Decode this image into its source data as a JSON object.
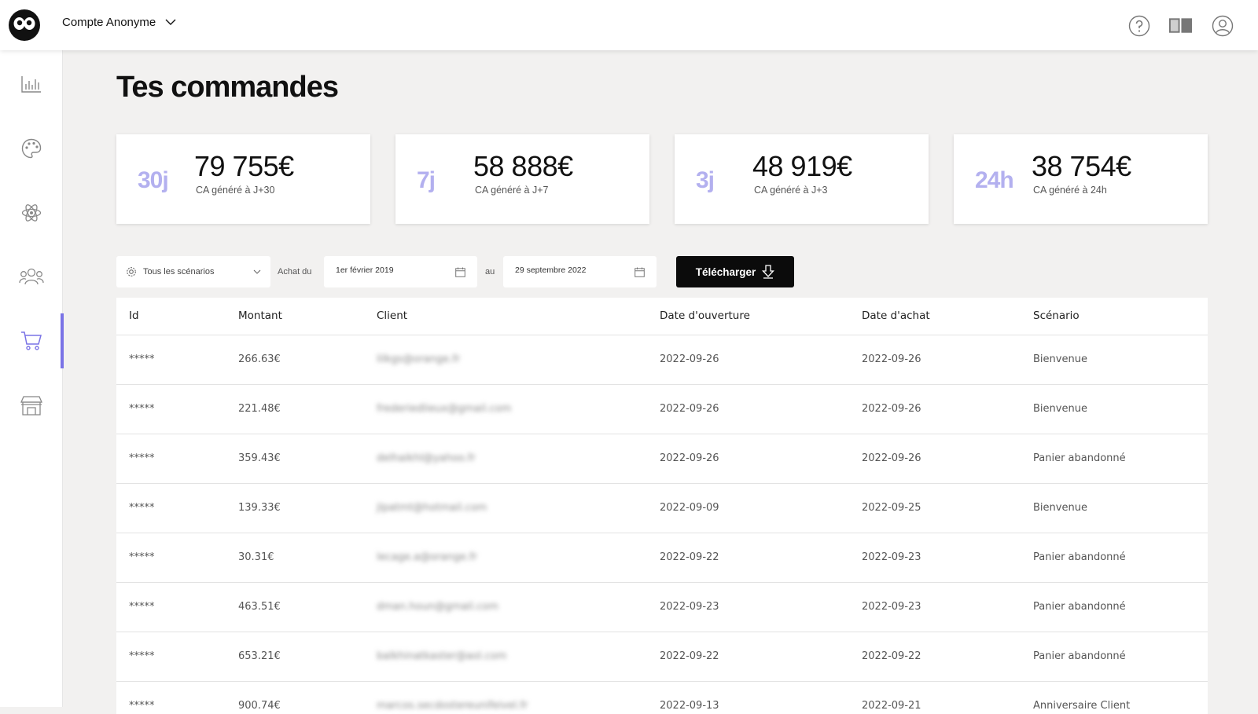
{
  "header": {
    "account_name": "Compte Anonyme",
    "icons": [
      "help-icon",
      "book-icon",
      "user-icon"
    ]
  },
  "sidebar": {
    "items": [
      {
        "name": "stats",
        "icon": "bar-chart-icon",
        "active": false
      },
      {
        "name": "design",
        "icon": "palette-icon",
        "active": false
      },
      {
        "name": "scenarios",
        "icon": "atom-icon",
        "active": false
      },
      {
        "name": "contacts",
        "icon": "users-icon",
        "active": false
      },
      {
        "name": "orders",
        "icon": "cart-icon",
        "active": true
      },
      {
        "name": "shop",
        "icon": "store-icon",
        "active": false
      }
    ],
    "accent": "#7a73e6"
  },
  "page": {
    "title": "Tes commandes"
  },
  "stats": [
    {
      "period": "30j",
      "value": "79 755€",
      "label": "CA généré à J+30"
    },
    {
      "period": "7j",
      "value": "58 888€",
      "label": "CA généré à J+7"
    },
    {
      "period": "3j",
      "value": "48 919€",
      "label": "CA généré à J+3"
    },
    {
      "period": "24h",
      "value": "38 754€",
      "label": "CA généré à 24h"
    }
  ],
  "filters": {
    "scenario_select": "Tous les scénarios",
    "from_label": "Achat du",
    "from_date": "1er février 2019",
    "to_label": "au",
    "to_date": "29 septembre 2022",
    "download_label": "Télécharger"
  },
  "table": {
    "headers": [
      "Id",
      "Montant",
      "Client",
      "Date d'ouverture",
      "Date d'achat",
      "Scénario"
    ],
    "rows": [
      [
        "*****",
        "266.63€",
        "lilkgs@orange.fr",
        "2022-09-26",
        "2022-09-26",
        "Bienvenue"
      ],
      [
        "*****",
        "221.48€",
        "frederiedlieux@gmail.com",
        "2022-09-26",
        "2022-09-26",
        "Bienvenue"
      ],
      [
        "*****",
        "359.43€",
        "delhaikhl@yahoo.fr",
        "2022-09-26",
        "2022-09-26",
        "Panier abandonné"
      ],
      [
        "*****",
        "139.33€",
        "jlpatmt@hotmail.com",
        "2022-09-09",
        "2022-09-25",
        "Bienvenue"
      ],
      [
        "*****",
        "30.31€",
        "lecage.a@orange.fr",
        "2022-09-22",
        "2022-09-23",
        "Panier abandonné"
      ],
      [
        "*****",
        "463.51€",
        "dman.houn@gmail.com",
        "2022-09-23",
        "2022-09-23",
        "Panier abandonné"
      ],
      [
        "*****",
        "653.21€",
        "balkhinatkaster@aol.com",
        "2022-09-22",
        "2022-09-22",
        "Panier abandonné"
      ],
      [
        "*****",
        "900.74€",
        "marcos.secdostereunifeivel.fr",
        "2022-09-13",
        "2022-09-21",
        "Anniversaire Client"
      ]
    ]
  }
}
